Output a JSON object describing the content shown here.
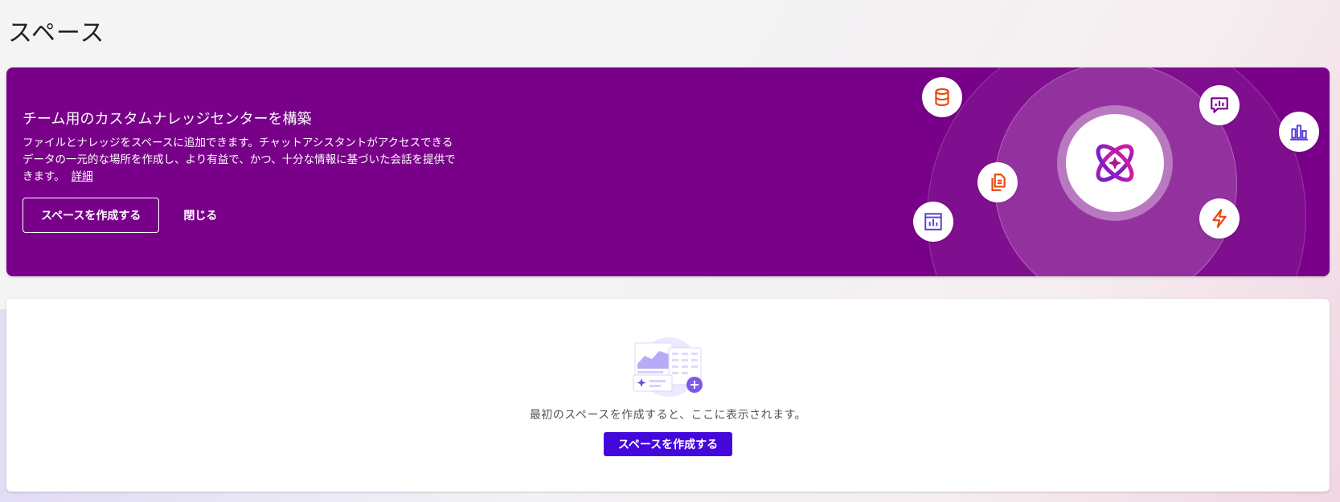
{
  "page": {
    "title": "スペース"
  },
  "hero": {
    "title": "チーム用のカスタムナレッジセンターを構築",
    "description": "ファイルとナレッジをスペースに追加できます。チャットアシスタントがアクセスできるデータの一元的な場所を作成し、より有益で、かつ、十分な情報に基づいた会話を提供できます。",
    "learn_more": "詳細",
    "create_button": "スペースを作成する",
    "close_button": "閉じる",
    "icons": [
      "database-icon",
      "chat-icon",
      "bar-chart-icon",
      "documents-icon",
      "report-icon",
      "lightning-icon",
      "assistant-logo-icon"
    ]
  },
  "empty_state": {
    "message": "最初のスペースを作成すると、ここに表示されます。",
    "create_button": "スペースを作成する"
  },
  "colors": {
    "hero_bg": "#790189",
    "primary_button": "#4508db",
    "icon_orange": "#e8470f",
    "icon_purple": "#7a048a",
    "icon_blue": "#5a3dd6"
  }
}
